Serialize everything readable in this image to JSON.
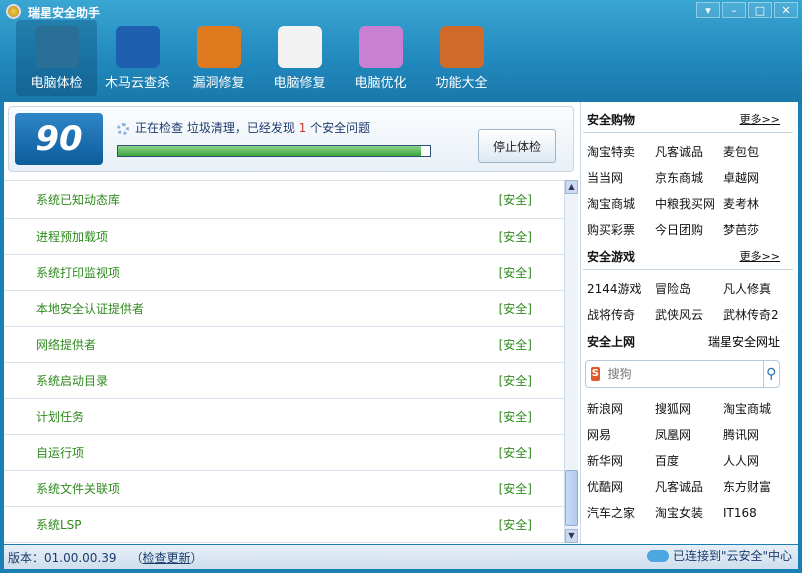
{
  "app": {
    "title": "瑞星安全助手"
  },
  "window": {
    "menu": "▾",
    "minimize": "–",
    "maximize": "□",
    "close": "✕"
  },
  "toolbar": [
    {
      "label": "电脑体检",
      "icon": "monitor-check-icon",
      "color": "#2a6f96"
    },
    {
      "label": "木马云查杀",
      "icon": "shield-icon",
      "color": "#1f5fb0"
    },
    {
      "label": "漏洞修复",
      "icon": "windows-refresh-icon",
      "color": "#e07a1f"
    },
    {
      "label": "电脑修复",
      "icon": "checklist-icon",
      "color": "#f2f2f2"
    },
    {
      "label": "电脑优化",
      "icon": "magic-wand-monitor-icon",
      "color": "#c97fd2"
    },
    {
      "label": "功能大全",
      "icon": "disc-box-icon",
      "color": "#d06a2a"
    }
  ],
  "scan": {
    "score": "90",
    "status_prefix": "正在检查  垃圾清理，已经发现",
    "issues": "1",
    "status_suffix": "个安全问题",
    "progress": 0.97,
    "stop_label": "停止体检"
  },
  "items": [
    {
      "name": "系统已知动态库",
      "status": "[安全]"
    },
    {
      "name": "进程预加载项",
      "status": "[安全]"
    },
    {
      "name": "系统打印监视项",
      "status": "[安全]"
    },
    {
      "name": "本地安全认证提供者",
      "status": "[安全]"
    },
    {
      "name": "网络提供者",
      "status": "[安全]"
    },
    {
      "name": "系统启动目录",
      "status": "[安全]"
    },
    {
      "name": "计划任务",
      "status": "[安全]"
    },
    {
      "name": "自运行项",
      "status": "[安全]"
    },
    {
      "name": "系统文件关联项",
      "status": "[安全]"
    },
    {
      "name": "系统LSP",
      "status": "[安全]"
    }
  ],
  "shopping": {
    "title": "安全购物",
    "more": "更多>>",
    "links": [
      "淘宝特卖",
      "凡客诚品",
      "麦包包",
      "当当网",
      "京东商城",
      "卓越网",
      "淘宝商城",
      "中粮我买网",
      "麦考林",
      "购买彩票",
      "今日团购",
      "梦芭莎"
    ]
  },
  "games": {
    "title": "安全游戏",
    "more": "更多>>",
    "links": [
      "2144游戏",
      "冒险岛",
      "凡人修真",
      "战将传奇",
      "武侠风云",
      "武林传奇2"
    ]
  },
  "web": {
    "title": "安全上网",
    "link": "瑞星安全网址",
    "search_placeholder": "搜狗",
    "search_logo": "S",
    "links": [
      "新浪网",
      "搜狐网",
      "淘宝商城",
      "网易",
      "凤凰网",
      "腾讯网",
      "新华网",
      "百度",
      "人人网",
      "优酷网",
      "凡客诚品",
      "东方财富",
      "汽车之家",
      "淘宝女装",
      "IT168"
    ]
  },
  "footer": {
    "version": "版本：01.00.00.39",
    "update_open": "（",
    "update": "检查更新",
    "update_close": "）",
    "cloud_status": "已连接到\"云安全\"中心"
  }
}
